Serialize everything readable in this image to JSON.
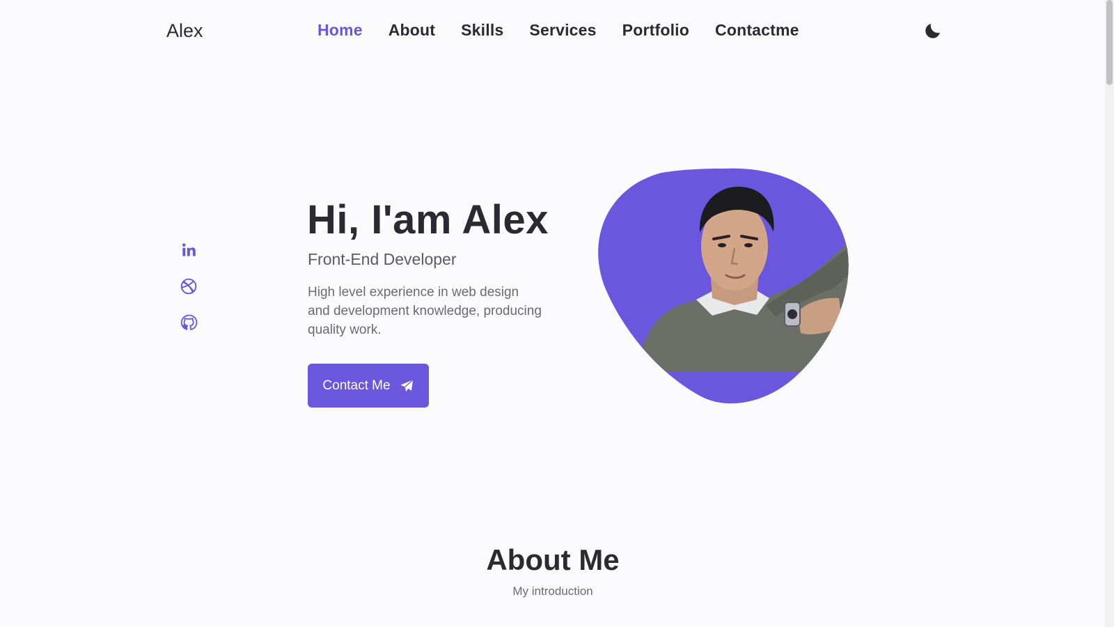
{
  "header": {
    "logo": "Alex",
    "nav": [
      "Home",
      "About",
      "Skills",
      "Services",
      "Portfolio",
      "Contactme"
    ],
    "active_nav": "Home",
    "theme_icon": "moon-icon"
  },
  "social": [
    "linkedin-icon",
    "dribbble-icon",
    "github-icon"
  ],
  "hero": {
    "title": "Hi, I'am Alex",
    "subtitle": "Front-End Developer",
    "description": "High level experience in web design and development knowledge, producing quality work.",
    "button_label": "Contact Me",
    "button_icon": "send-icon",
    "photo": "profile-photo"
  },
  "about": {
    "title": "About Me",
    "subtitle": "My introduction"
  },
  "colors": {
    "accent": "#6a57de",
    "text": "#2b2a33",
    "background": "#fbfbfe"
  }
}
